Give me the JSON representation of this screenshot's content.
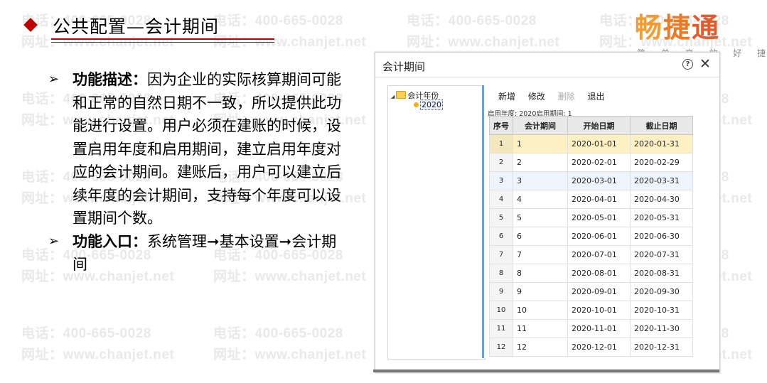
{
  "watermark": {
    "phone": "电话：400-665-0028",
    "web": "网址：www.chanjet.net"
  },
  "title": "公共配置—会计期间",
  "logo": {
    "text": [
      "畅",
      "捷",
      "通"
    ],
    "slogan": "简 单 高 效 好 捷 通"
  },
  "content": {
    "bullets": [
      {
        "label": "功能描述：",
        "text": "因为企业的实际核算期间可能和正常的自然日期不一致，所以提供此功能进行设置。用户必须在建账的时候，设置启用年度和启用期间，建立启用年度对应的会计期间。建账后，用户可以建立后续年度的会计期间，支持每个年度可以设置期间个数。"
      },
      {
        "label": "功能入口：",
        "text": "系统管理➞基本设置➞会计期间"
      }
    ]
  },
  "dialog": {
    "title": "会计期间",
    "help_icon": "question-circle-icon",
    "close_icon": "close-icon",
    "tree": {
      "root_label": "会计年份",
      "child_label": "2020"
    },
    "toolbar": {
      "add": "新增",
      "edit": "修改",
      "delete": "删除",
      "exit": "退出"
    },
    "info": "启用年度:  2020启用期间:  1",
    "columns": [
      "序号",
      "会计期间",
      "开始日期",
      "截止日期"
    ],
    "rows": [
      {
        "no": "1",
        "period": "1",
        "start": "2020-01-01",
        "end": "2020-01-31"
      },
      {
        "no": "2",
        "period": "2",
        "start": "2020-02-01",
        "end": "2020-02-29"
      },
      {
        "no": "3",
        "period": "3",
        "start": "2020-03-01",
        "end": "2020-03-31"
      },
      {
        "no": "4",
        "period": "4",
        "start": "2020-04-01",
        "end": "2020-04-30"
      },
      {
        "no": "5",
        "period": "5",
        "start": "2020-05-01",
        "end": "2020-05-31"
      },
      {
        "no": "6",
        "period": "6",
        "start": "2020-06-01",
        "end": "2020-06-30"
      },
      {
        "no": "7",
        "period": "7",
        "start": "2020-07-01",
        "end": "2020-07-31"
      },
      {
        "no": "8",
        "period": "8",
        "start": "2020-08-01",
        "end": "2020-08-31"
      },
      {
        "no": "9",
        "period": "9",
        "start": "2020-09-01",
        "end": "2020-09-30"
      },
      {
        "no": "10",
        "period": "10",
        "start": "2020-10-01",
        "end": "2020-10-31"
      },
      {
        "no": "11",
        "period": "11",
        "start": "2020-11-01",
        "end": "2020-11-30"
      },
      {
        "no": "12",
        "period": "12",
        "start": "2020-12-01",
        "end": "2020-12-31"
      }
    ]
  },
  "colors": {
    "accent": "#c00000",
    "logo_orange": "#ef7a22",
    "selected_row": "#fdf0c2",
    "splitter": "#6f9fd8"
  }
}
